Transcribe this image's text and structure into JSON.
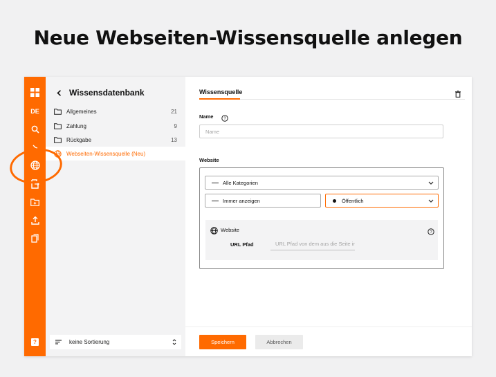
{
  "headline": "Neue Webseiten-Wissensquelle anlegen",
  "colors": {
    "accent": "#ff6a00",
    "panel": "#f3f3f4"
  },
  "rail": {
    "lang": "DE",
    "icons": [
      "dashboard-icon",
      "search-icon",
      "history-icon",
      "globe-icon",
      "file-transfer-icon",
      "folder-plus-icon",
      "upload-icon",
      "copy-icon",
      "help-icon"
    ],
    "help_label": "?"
  },
  "tree": {
    "title": "Wissensdatenbank",
    "items": [
      {
        "label": "Allgemeines",
        "count": "21",
        "icon": "folder-icon"
      },
      {
        "label": "Zahlung",
        "count": "9",
        "icon": "folder-icon"
      },
      {
        "label": "Rückgabe",
        "count": "13",
        "icon": "folder-icon"
      },
      {
        "label": "Webseiten-Wissensquelle (Neu)",
        "count": "",
        "icon": "globe-icon"
      }
    ],
    "sort_label": "keine Sortierung"
  },
  "form": {
    "tab": "Wissensquelle",
    "name_label": "Name",
    "name_placeholder": "Name",
    "website_label": "Website",
    "category_select": "Alle Kategorien",
    "display_select": "Immer anzeigen",
    "visibility_select": "Öffentlich",
    "website_card_title": "Website",
    "url_label": "URL Pfad",
    "url_placeholder": "URL Pfad von dem aus die Seite importiert werden soll",
    "save_label": "Speichern",
    "cancel_label": "Abbrechen"
  }
}
